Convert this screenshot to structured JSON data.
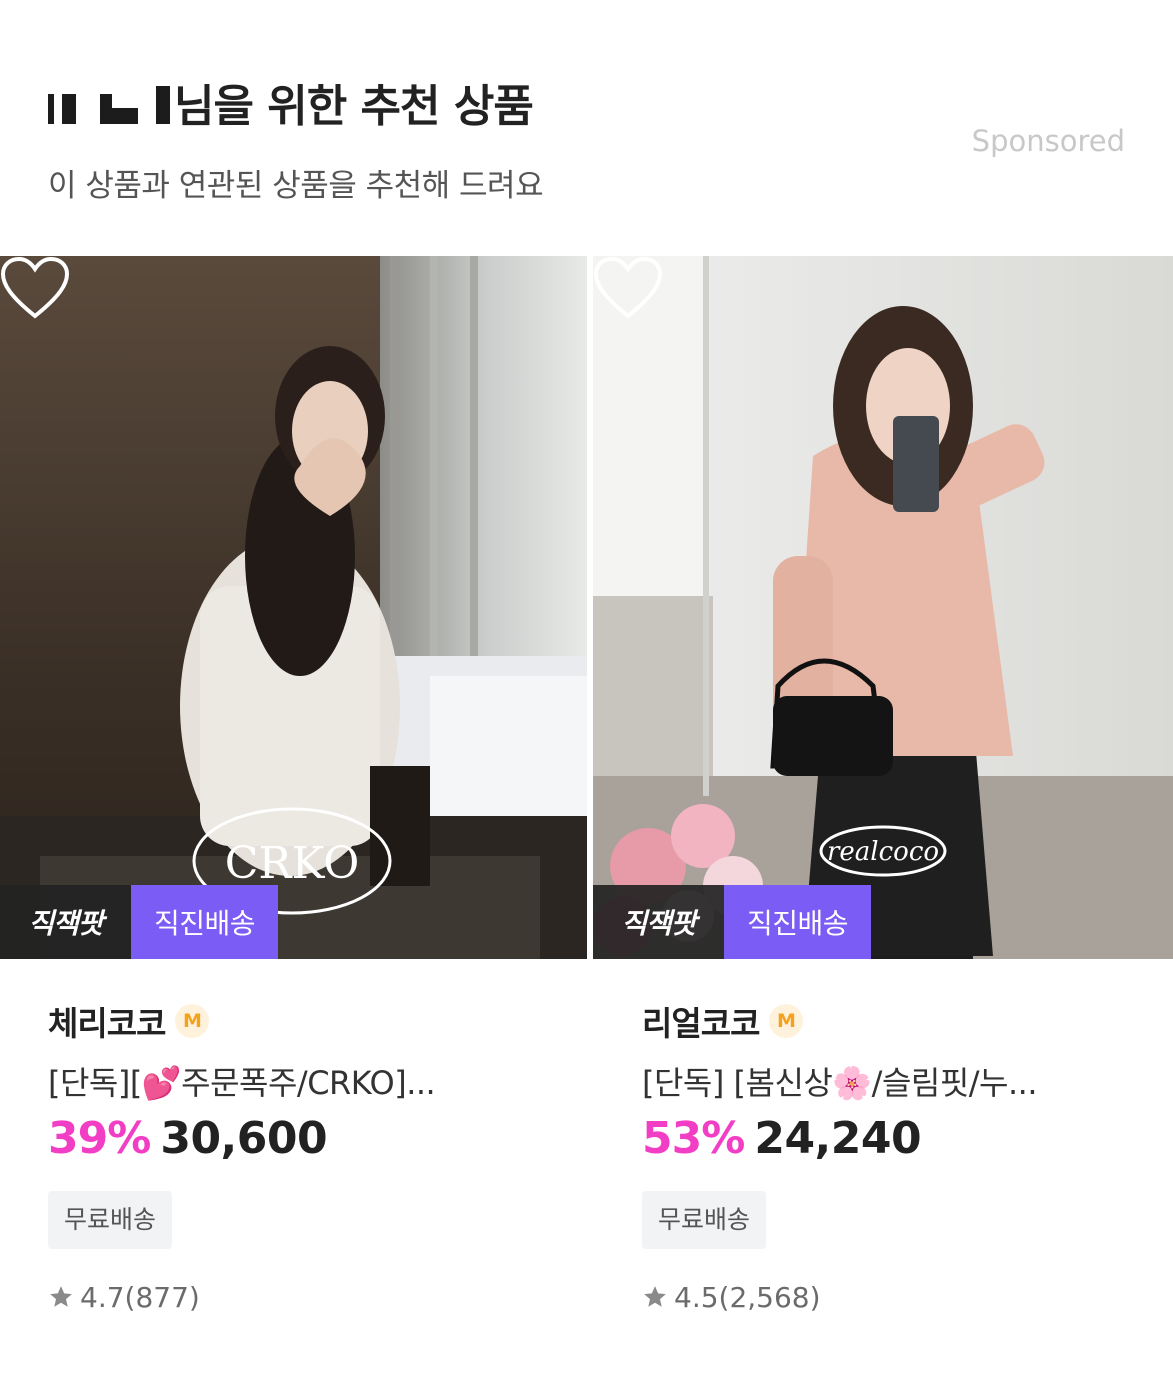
{
  "header": {
    "title": "님을 위한 추천 상품",
    "subtitle": "이 상품과 연관된 상품을 추천해 드려요",
    "sponsored": "Sponsored"
  },
  "products": [
    {
      "badge_dark": "직잭팟",
      "badge_purple": "직진배송",
      "watermark": "CRKO",
      "brand": "체리코코",
      "brand_badge": "M",
      "name": "[단독][💕주문폭주/CRKO]...",
      "discount": "39%",
      "price": "30,600",
      "shipping": "무료배송",
      "rating": "4.7",
      "reviews": "(877)"
    },
    {
      "badge_dark": "직잭팟",
      "badge_purple": "직진배송",
      "watermark": "realcoco",
      "brand": "리얼코코",
      "brand_badge": "M",
      "name": "[단독] [봄신상🌸/슬림핏/누...",
      "discount": "53%",
      "price": "24,240",
      "shipping": "무료배송",
      "rating": "4.5",
      "reviews": "(2,568)"
    }
  ],
  "colors": {
    "discount": "#f23ec5",
    "badge_purple": "#7b5cf5",
    "badge_dark": "#232323",
    "brand_badge": "#f4a21e"
  },
  "icons": [
    "heart-icon",
    "star-icon"
  ]
}
